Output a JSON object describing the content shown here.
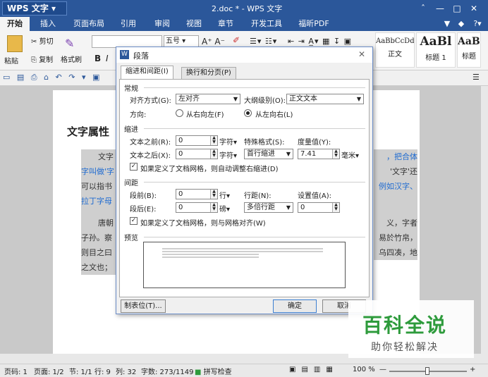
{
  "app": {
    "name": "WPS 文字",
    "doc_title": "2.doc * - WPS 文字"
  },
  "menu": [
    "开始",
    "插入",
    "页面布局",
    "引用",
    "审阅",
    "视图",
    "章节",
    "开发工具",
    "福昕PDF"
  ],
  "ribbon": {
    "paste": "粘贴",
    "cut": "剪切",
    "copy": "复制",
    "format_painter": "格式刷",
    "font_size": "五号",
    "bold": "B",
    "italic": "I",
    "styles": [
      {
        "sample": "AaBbCcDd",
        "label": "正文"
      },
      {
        "sample": "AaBl",
        "label": "标题 1"
      },
      {
        "sample": "AaBl",
        "label": "标题"
      }
    ]
  },
  "document": {
    "heading": "文字属性",
    "left_lines": [
      "文字",
      "字叫做'字",
      "可以指书",
      "拉丁字母",
      "唐朝",
      "子孙。察",
      "则目之曰",
      "之文也；"
    ],
    "right_lines": [
      "，把合体",
      "'文字'还",
      "例如汉字、",
      "义，字者",
      "易於竹帛，",
      "乌四凑，地"
    ]
  },
  "dialog": {
    "title": "段落",
    "tabs": [
      "缩进和间距(I)",
      "换行和分页(P)"
    ],
    "general": {
      "section": "常规",
      "alignment_label": "对齐方式(G):",
      "alignment_value": "左对齐",
      "outline_label": "大纲级别(O):",
      "outline_value": "正文文本",
      "direction_label": "方向:",
      "rtl_label": "从右向左(F)",
      "ltr_label": "从左向右(L)"
    },
    "indent": {
      "section": "缩进",
      "before_label": "文本之前(R):",
      "before_value": "0",
      "before_unit": "字符▾",
      "after_label": "文本之后(X):",
      "after_value": "0",
      "after_unit": "字符▾",
      "special_label": "特殊格式(S):",
      "special_value": "首行缩进",
      "measure_label": "度量值(Y):",
      "measure_value": "7.41",
      "measure_unit": "毫米▾",
      "grid_check": "如果定义了文档网格，则自动调整右缩进(D)"
    },
    "spacing": {
      "section": "间距",
      "before_label": "段前(B):",
      "before_value": "0",
      "before_unit": "行▾",
      "after_label": "段后(E):",
      "after_value": "0",
      "after_unit": "磅▾",
      "line_label": "行距(N):",
      "line_value": "多倍行距",
      "setting_label": "设置值(A):",
      "setting_value": "0",
      "grid_check": "如果定义了文档网格，则与网格对齐(W)"
    },
    "preview_label": "预览",
    "tabstops_button": "制表位(T)...",
    "ok_button": "确定",
    "cancel_button": "取消"
  },
  "status": {
    "page": "页码: 1",
    "pages": "页面: 1/2",
    "section": "节: 1/1",
    "row": "行: 9",
    "col": "列: 32",
    "words": "字数: 273/1149",
    "spellcheck": "拼写检查",
    "zoom": "100 %"
  },
  "watermark": {
    "title": "百科全说",
    "subtitle": "助你轻松解决"
  },
  "colors": {
    "titlebar": "#2b579a",
    "link": "#1f6bd1",
    "highlight": "#cfcfcf",
    "watermark_green": "#2e9b3c"
  }
}
